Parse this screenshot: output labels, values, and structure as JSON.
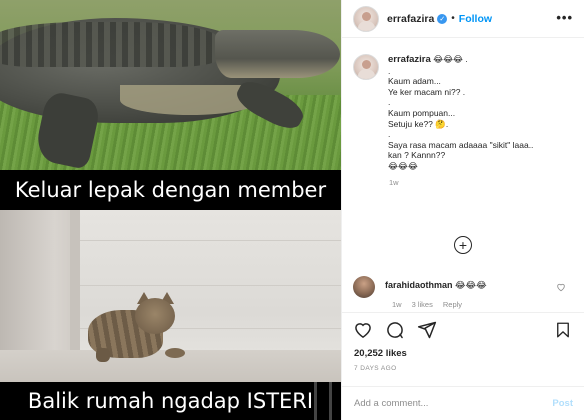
{
  "meme": {
    "top_caption": "Keluar lepak dengan member",
    "bottom_caption": "Balik rumah ngadap ISTERI"
  },
  "header": {
    "username": "errafazira",
    "separator": "•",
    "follow_label": "Follow",
    "more_label": "•••",
    "verified_icon": "verified-badge-icon"
  },
  "post": {
    "username": "errafazira",
    "caption_lines": [
      "😂😂😂 .",
      ".",
      "Kaum adam...",
      "Ye ker macam ni?? .",
      ".",
      "Kaum pompuan...",
      "Setuju ke?? 🤔.",
      ".",
      "Saya rasa macam adaaaa \"sikit\" laaa..",
      "kan ? Kannn??",
      "😂😂😂"
    ],
    "time": "1w"
  },
  "load_more_icon": "plus-circle-icon",
  "comment": {
    "username": "farahidaothman",
    "text": "😂😂😂",
    "time": "1w",
    "likes": "3 likes",
    "reply": "Reply"
  },
  "actions": {
    "like_icon": "heart-icon",
    "comment_icon": "comment-icon",
    "share_icon": "share-icon",
    "save_icon": "bookmark-icon",
    "likes_count": "20,252 likes",
    "date": "7 DAYS AGO"
  },
  "composer": {
    "placeholder": "Add a comment...",
    "post_label": "Post"
  },
  "colors": {
    "accent": "#0095f6",
    "muted": "#8e8e8e",
    "text": "#262626",
    "border": "#efefef"
  }
}
